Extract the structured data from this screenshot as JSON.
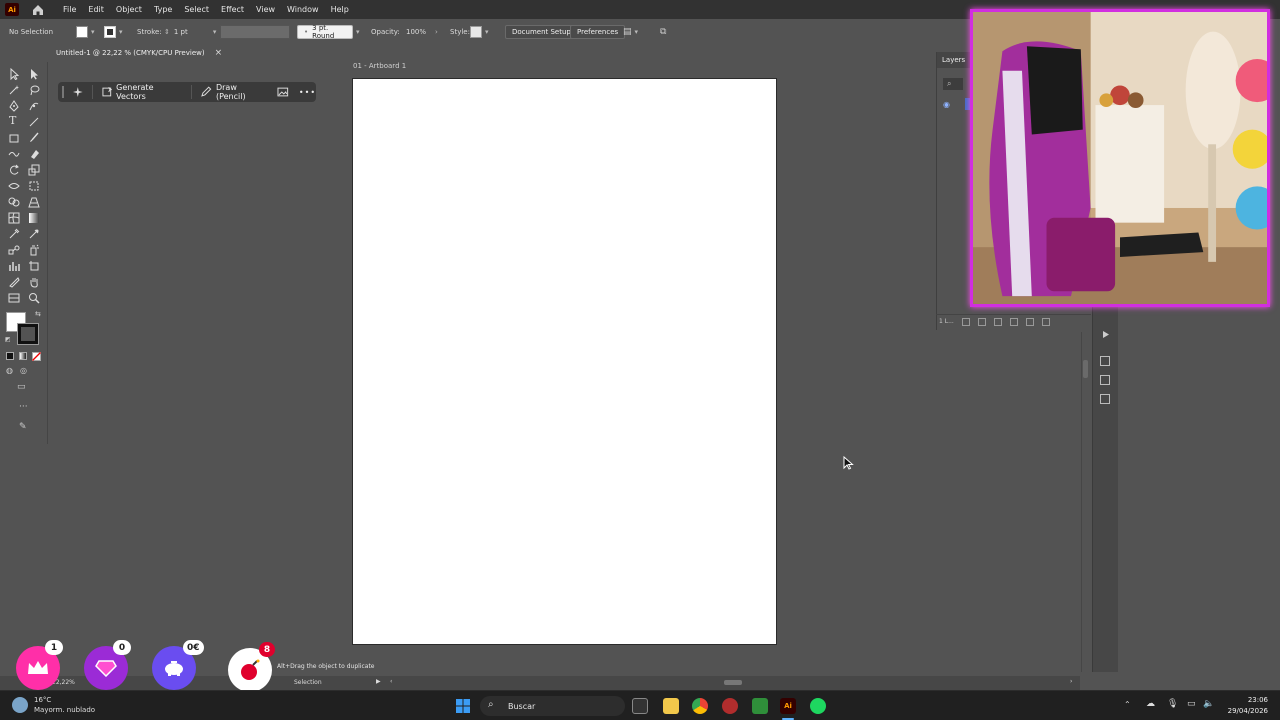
{
  "menubar": {
    "items": [
      "File",
      "Edit",
      "Object",
      "Type",
      "Select",
      "Effect",
      "View",
      "Window",
      "Help"
    ],
    "icons": [
      "ai-logo-icon",
      "home-icon"
    ]
  },
  "controlbar": {
    "selection_status": "No Selection",
    "stroke_label": "Stroke:",
    "stroke_value": "1 pt",
    "brush_value": "3 pt. Round",
    "opacity_label": "Opacity:",
    "opacity_value": "100%",
    "style_label": "Style:",
    "document_setup": "Document Setup",
    "preferences": "Preferences"
  },
  "document": {
    "tab_title": "Untitled-1 @ 22,22 % (CMYK/CPU Preview)",
    "close_glyph": "×",
    "artboard_label": "01 - Artboard 1"
  },
  "contextual_taskbar": {
    "generate_vectors": "Generate Vectors",
    "draw_pencil": "Draw (Pencil)",
    "more": "•••"
  },
  "layers_panel": {
    "title": "Layers",
    "footer_count": "1 L..."
  },
  "statusbar": {
    "zoom": "22,22%",
    "tool": "Selection",
    "hint": "Alt+Drag the object to duplicate"
  },
  "stream_overlay": {
    "crown_count": "1",
    "gem_count": "0",
    "piggy_amount": "0€",
    "bomb_count": "8",
    "colors": {
      "crown": "#ff2fa8",
      "gem": "#9b2bd6",
      "piggy": "#6a4df0",
      "bomb": "#ffffff"
    }
  },
  "windows_taskbar": {
    "search_placeholder": "Buscar",
    "weather_temp": "16°C",
    "weather_desc": "Mayorm. nublado",
    "time": "23:06",
    "date": "29/04/2026"
  },
  "colors": {
    "app_bg": "#535353",
    "menubar_bg": "#323232",
    "artboard": "#ffffff",
    "webcam_border": "#d12ee0",
    "ai_orange": "#ff9a00"
  }
}
